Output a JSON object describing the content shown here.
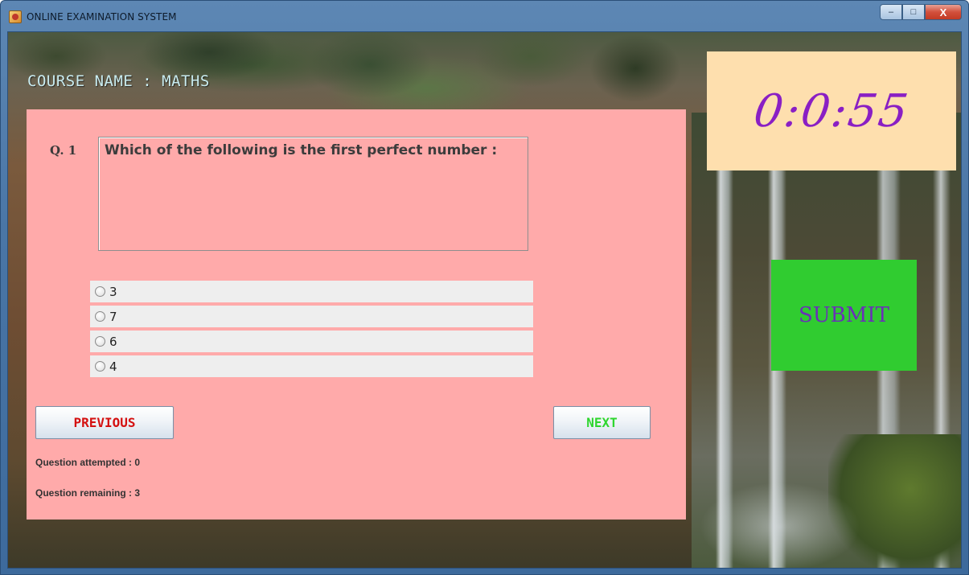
{
  "window": {
    "title": "ONLINE EXAMINATION SYSTEM",
    "controls": {
      "minimize": "–",
      "maximize": "□",
      "close": "X"
    }
  },
  "course": {
    "label": "COURSE NAME : MATHS"
  },
  "question": {
    "number_label": "Q. 1",
    "text": "Which of the following is the first perfect number :",
    "options": [
      "3",
      "7",
      "6",
      "4"
    ],
    "selected": null
  },
  "navigation": {
    "previous_label": "PREVIOUS",
    "next_label": "NEXT"
  },
  "status": {
    "attempted": "Question attempted : 0",
    "remaining": "Question remaining : 3"
  },
  "timer": {
    "value": "0:0:55"
  },
  "submit": {
    "label": "SUBMIT"
  },
  "colors": {
    "panel": "#ffaaaa",
    "timer_bg": "#fedfae",
    "timer_text": "#8a1fc4",
    "submit_bg": "#30cc30",
    "submit_text": "#6a30b8",
    "previous_text": "#d41111",
    "next_text": "#2fd62f"
  }
}
